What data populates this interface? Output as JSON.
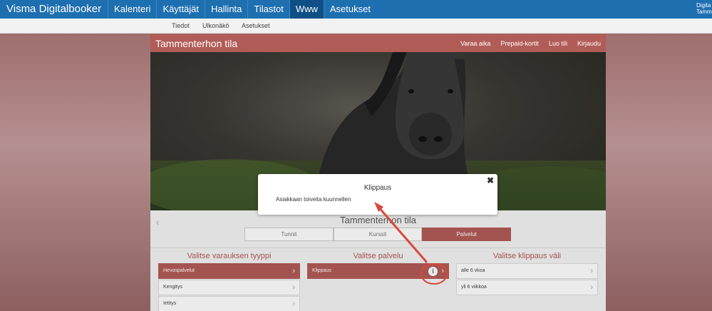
{
  "topbar": {
    "brand": "Visma Digitalbooker",
    "items": [
      "Kalenteri",
      "Käyttäjät",
      "Hallinta",
      "Tilastot",
      "Www",
      "Asetukset"
    ],
    "active_index": 4,
    "account_line1": "Digita",
    "account_line2": "Tamme"
  },
  "subbar": {
    "items": [
      "Tiedot",
      "Ulkonäkö",
      "Asetukset"
    ]
  },
  "panel": {
    "title": "Tammenterhon tila",
    "links": [
      "Varaa aika",
      "Prepaid-kortit",
      "Luo tili",
      "Kirjaudu"
    ]
  },
  "booking": {
    "title": "Tammenterhon tila",
    "tabs": [
      "Tunnit",
      "Kurssit",
      "Palvelut"
    ],
    "active_tab": 2,
    "columns": [
      {
        "heading": "Valitse varauksen tyyppi",
        "rows": [
          "Hevospalvelut",
          "Kengitys",
          "Ietitys"
        ],
        "active_row": 0
      },
      {
        "heading": "Valitse palvelu",
        "rows": [
          "Klippaus"
        ],
        "active_row": 0
      },
      {
        "heading": "Valitse klippaus väli",
        "rows": [
          "alle 6 vkoa",
          "yli 6 viikkoa"
        ],
        "active_row": -1
      }
    ]
  },
  "modal": {
    "title": "Klippaus",
    "body": "Asiakkaan toiveita kuunnellen",
    "close_glyph": "✖"
  },
  "icons": {
    "back": "chevron-left-icon",
    "row": "chevron-right-icon",
    "info": "info-icon",
    "close": "close-icon"
  },
  "colors": {
    "nav_blue": "#1d6fb0",
    "accent": "#b25c57",
    "annotation_red": "#d9483b"
  }
}
